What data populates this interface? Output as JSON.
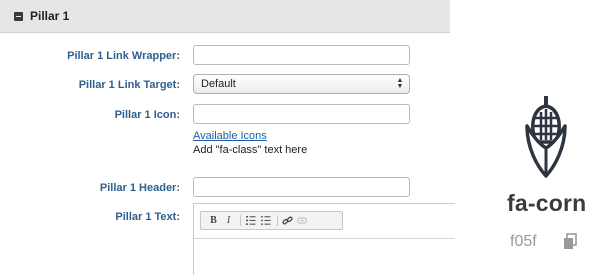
{
  "section": {
    "title": "Pillar 1",
    "collapse_icon": "minus-square-icon"
  },
  "fields": {
    "link_wrapper": {
      "label": "Pillar 1 Link Wrapper:",
      "value": ""
    },
    "link_target": {
      "label": "Pillar 1 Link Target:",
      "value": "Default"
    },
    "icon": {
      "label": "Pillar 1 Icon:",
      "value": "",
      "help_link": "Available Icons",
      "help_text": "Add \"fa-class\" text here"
    },
    "header": {
      "label": "Pillar 1 Header:",
      "value": ""
    },
    "text": {
      "label": "Pillar 1 Text:",
      "toolbar": {
        "bold": "B",
        "italic": "I",
        "ordered_list_icon": "ordered-list-icon",
        "unordered_list_icon": "unordered-list-icon",
        "link_icon": "link-icon",
        "unlink_icon": "unlink-icon"
      }
    }
  },
  "icon_preview": {
    "name": "fa-corn",
    "code": "f05f",
    "glyph": "corn-icon",
    "copy_icon": "copy-icon"
  },
  "colors": {
    "label_blue": "#2f5f8f",
    "link_blue": "#1a5ea8",
    "header_bg": "#e6e6e6",
    "icon_dark": "#2e3540"
  }
}
